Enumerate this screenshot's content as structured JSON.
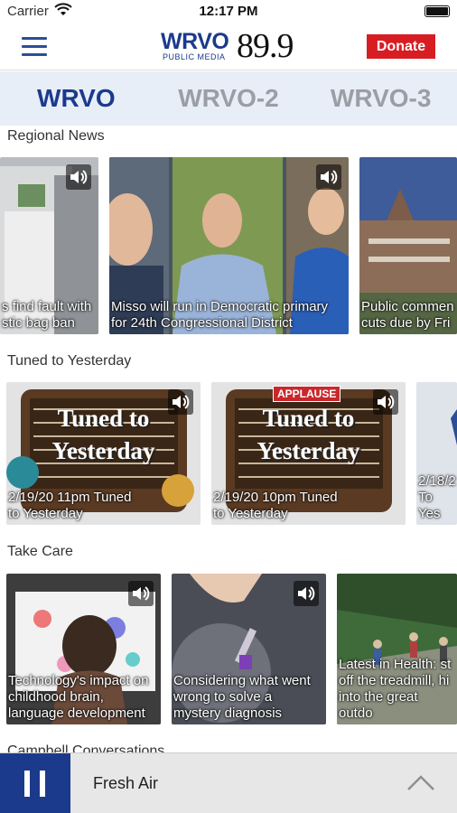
{
  "status_bar": {
    "carrier": "Carrier",
    "time": "12:17 PM"
  },
  "header": {
    "brand": "WRVO",
    "brand_sub": "PUBLIC MEDIA",
    "frequency": "89.9",
    "donate_label": "Donate"
  },
  "tabs": [
    {
      "label": "WRVO",
      "active": true
    },
    {
      "label": "WRVO-2",
      "active": false
    },
    {
      "label": "WRVO-3",
      "active": false
    }
  ],
  "sections": [
    {
      "title": "Regional News",
      "cards": [
        {
          "caption": "s find fault with\nstic bag ban",
          "image": "grocery-bags",
          "audio": true
        },
        {
          "caption": "Misso will run in Democratic primary\nfor 24th Congressional District",
          "image": "candidates-portraits",
          "audio": true
        },
        {
          "caption": "Public commen\ncuts due by Fri",
          "image": "capitol-building",
          "audio": false
        }
      ]
    },
    {
      "title": "Tuned to Yesterday",
      "cards": [
        {
          "caption": "2/19/20 11pm Tuned\nto Yesterday",
          "image": "radio-art",
          "art_text": "Tuned to\nYesterday",
          "audio": true
        },
        {
          "caption": "2/19/20 10pm Tuned\nto Yesterday",
          "image": "radio-art",
          "art_text": "Tuned to\nYesterday",
          "badge": "APPLAUSE",
          "audio": true
        },
        {
          "caption": "2/18/2\nTo Yes",
          "image": "partial",
          "audio": false
        }
      ]
    },
    {
      "title": "Take Care",
      "cards": [
        {
          "caption": "Technology's impact on\nchildhood brain,\nlanguage development",
          "image": "child-screen",
          "audio": true
        },
        {
          "caption": "Considering what went\nwrong to solve a\nmystery diagnosis",
          "image": "blood-test",
          "audio": true
        },
        {
          "caption": "Latest in Health: st\noff the treadmill, hi\ninto the great outdo",
          "image": "hikers",
          "audio": false
        }
      ]
    },
    {
      "title": "Campbell Conversations",
      "cards": []
    }
  ],
  "player": {
    "now_playing": "Fresh Air"
  },
  "colors": {
    "brand_blue": "#1c3a8c",
    "donate_red": "#d81d22",
    "tab_bg": "#e8eef7",
    "inactive_tab": "#9b9ea5"
  }
}
